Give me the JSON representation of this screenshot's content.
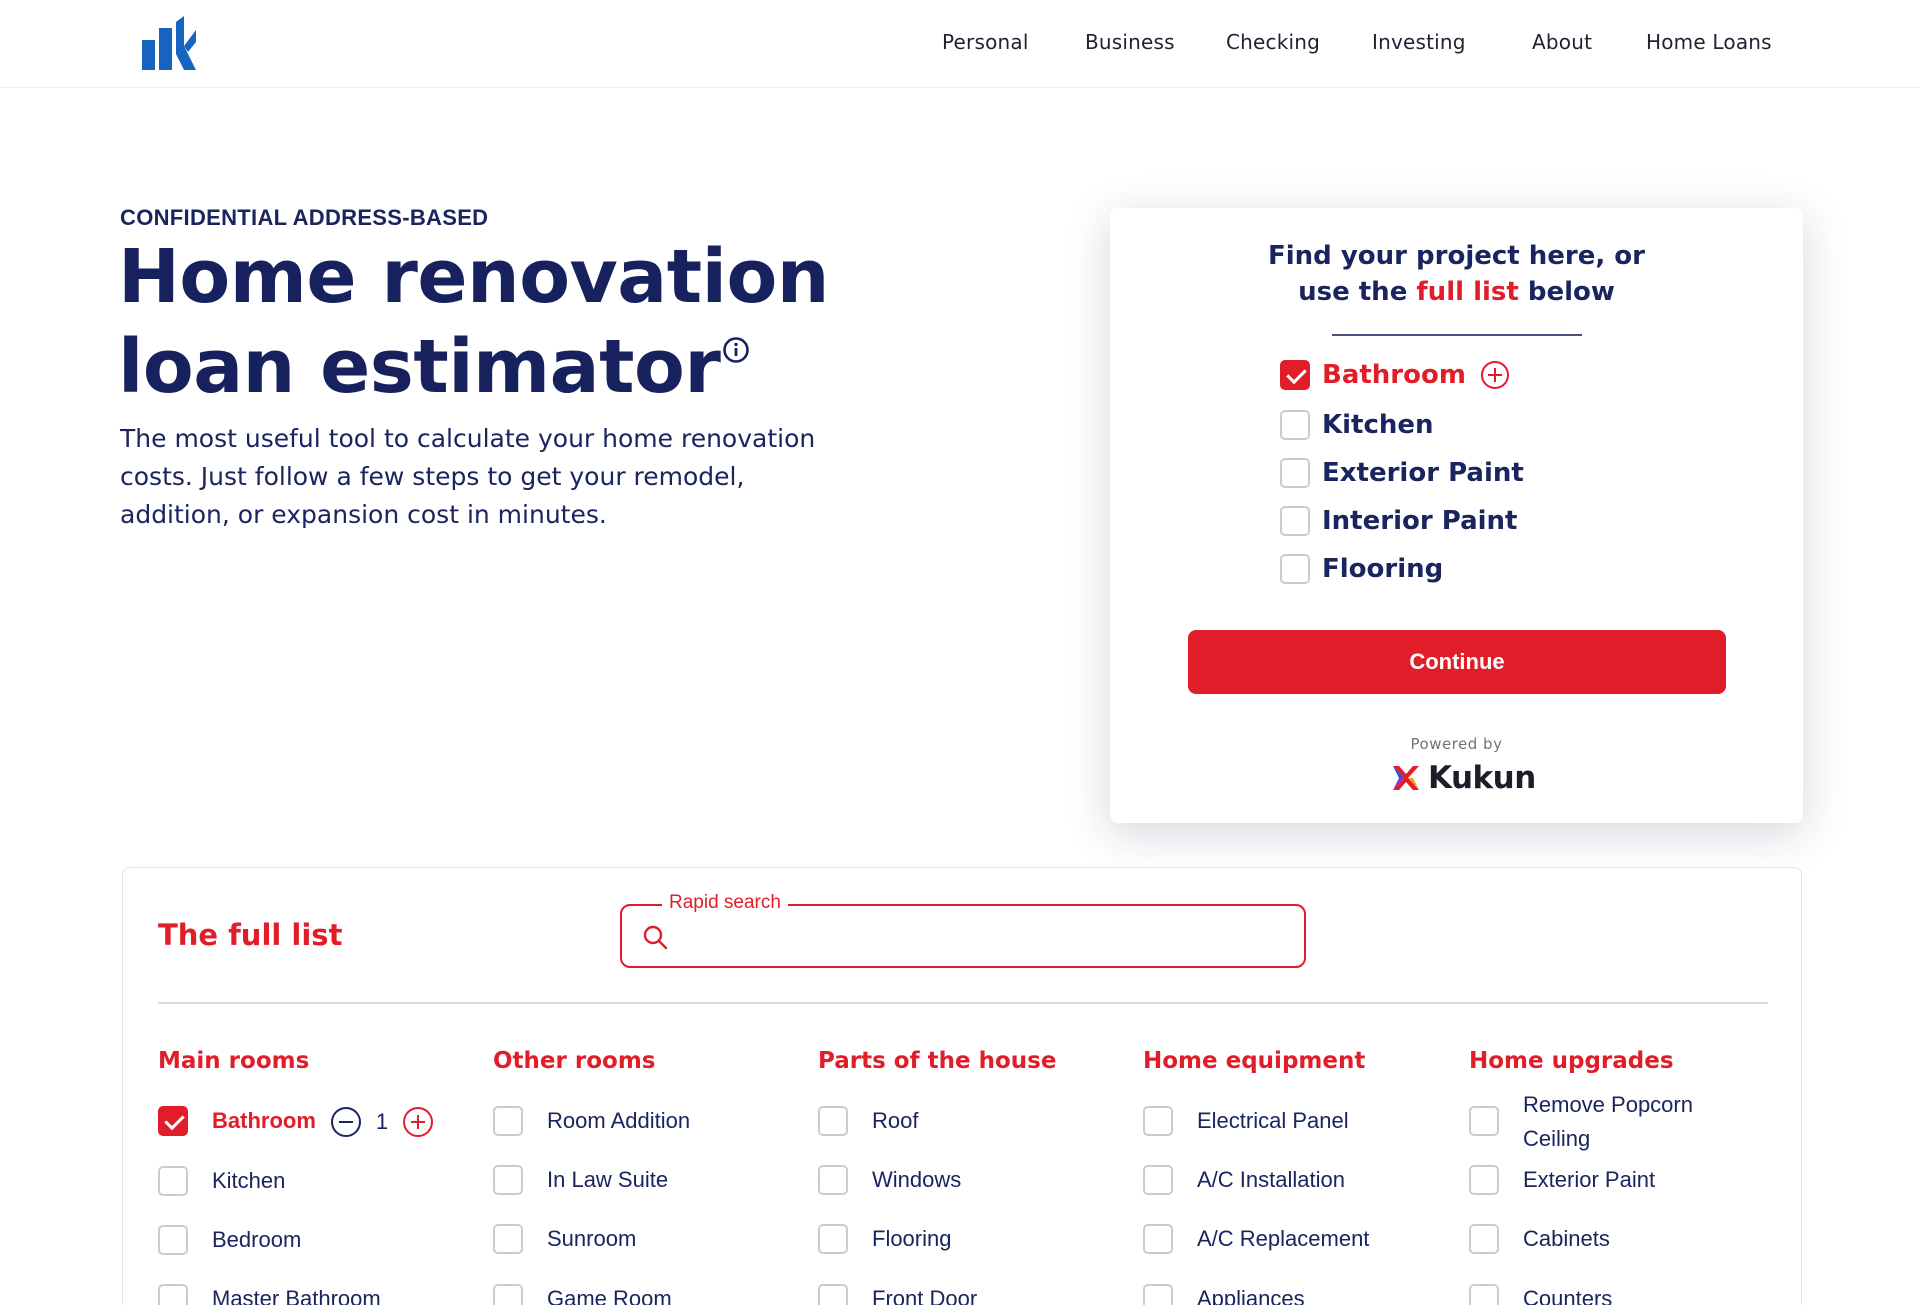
{
  "nav": {
    "items": [
      "Personal",
      "Business",
      "Checking",
      "Investing",
      "About",
      "Home Loans"
    ]
  },
  "hero": {
    "eyebrow": "CONFIDENTIAL ADDRESS-BASED",
    "title_line1": "Home renovation",
    "title_line2": "loan estimator",
    "description": "The most useful tool to calculate your home renovation costs. Just follow a few steps to get your remodel, addition, or expansion cost in minutes."
  },
  "card": {
    "title_line1": "Find your project here, or",
    "title_prefix": "use the ",
    "title_highlight": "full list",
    "title_suffix": " below",
    "items": [
      {
        "label": "Bathroom",
        "checked": true
      },
      {
        "label": "Kitchen",
        "checked": false
      },
      {
        "label": "Exterior Paint",
        "checked": false
      },
      {
        "label": "Interior Paint",
        "checked": false
      },
      {
        "label": "Flooring",
        "checked": false
      }
    ],
    "continue_label": "Continue",
    "powered_by": "Powered by",
    "brand": "Kukun"
  },
  "full_list": {
    "title": "The full list",
    "search_label": "Rapid search",
    "search_value": "",
    "bathroom_count": "1",
    "columns": [
      {
        "heading": "Main rooms",
        "items": [
          "Bathroom",
          "Kitchen",
          "Bedroom",
          "Master Bathroom"
        ]
      },
      {
        "heading": "Other rooms",
        "items": [
          "Room Addition",
          "In Law Suite",
          "Sunroom",
          "Game Room"
        ]
      },
      {
        "heading": "Parts of the house",
        "items": [
          "Roof",
          "Windows",
          "Flooring",
          "Front Door"
        ]
      },
      {
        "heading": "Home equipment",
        "items": [
          "Electrical Panel",
          "A/C Installation",
          "A/C Replacement",
          "Appliances"
        ]
      },
      {
        "heading": "Home upgrades",
        "items": [
          "Remove Popcorn",
          "Exterior Paint",
          "Cabinets",
          "Counters"
        ],
        "item0_line2": "Ceiling"
      }
    ]
  },
  "colors": {
    "brand_red": "#e11d2a",
    "navy": "#1a2560",
    "logo_blue": "#1565c0"
  }
}
